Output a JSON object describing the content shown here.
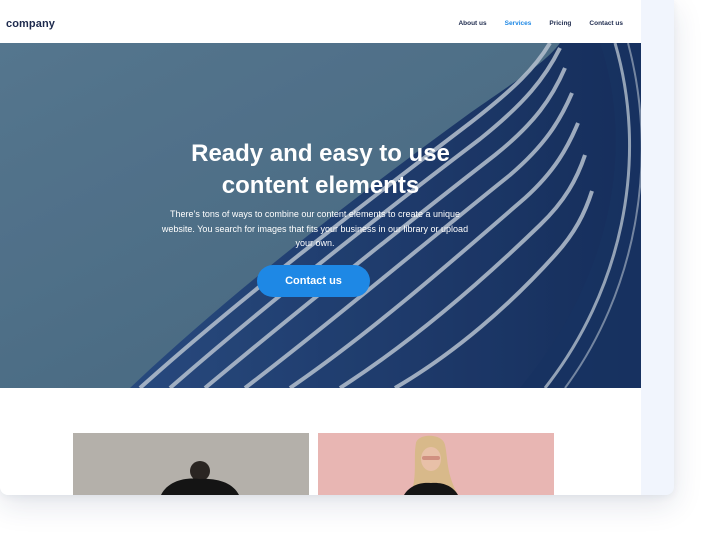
{
  "brand": {
    "name": "company",
    "accent_color": "#1e88e5"
  },
  "nav": {
    "links": [
      {
        "label": "About us"
      },
      {
        "label": "Services",
        "active": true
      },
      {
        "label": "Pricing"
      },
      {
        "label": "Contact us"
      }
    ]
  },
  "hero": {
    "title_line1": "Ready and easy to use",
    "title_line2": "content elements",
    "body": "There’s tons of ways to combine our content elements to create a unique website. You search for images that fits your business in our library or upload your own.",
    "cta_label": "Contact us"
  },
  "gallery": {
    "items": [
      {
        "icon": "photo-man-black-tee"
      },
      {
        "icon": "photo-woman-pink-wall"
      }
    ]
  }
}
